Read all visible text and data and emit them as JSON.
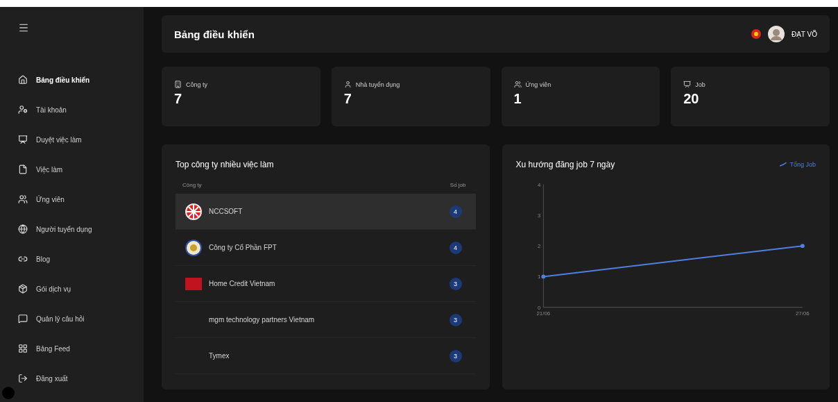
{
  "sidebar": {
    "items": [
      {
        "label": "Bảng điều khiển",
        "selected": true
      },
      {
        "label": "Tài khoản",
        "selected": false
      },
      {
        "label": "Duyệt việc làm",
        "selected": false
      },
      {
        "label": "Việc làm",
        "selected": false
      },
      {
        "label": "Ứng viên",
        "selected": false
      },
      {
        "label": "Người tuyển dụng",
        "selected": false
      },
      {
        "label": "Blog",
        "selected": false
      },
      {
        "label": "Gói dịch vụ",
        "selected": false
      },
      {
        "label": "Quản lý câu hỏi",
        "selected": false
      },
      {
        "label": "Bảng Feed",
        "selected": false
      },
      {
        "label": "Đăng xuất",
        "selected": false
      }
    ]
  },
  "header": {
    "title": "Bảng điều khiển",
    "user": "ĐẠT VÕ"
  },
  "stats": [
    {
      "label": "Công ty",
      "value": "7"
    },
    {
      "label": "Nhà tuyển dụng",
      "value": "7"
    },
    {
      "label": "Ứng viên",
      "value": "1"
    },
    {
      "label": "Job",
      "value": "20"
    }
  ],
  "top_companies": {
    "title": "Top công ty nhiều việc làm",
    "columns": [
      "Công ty",
      "Số job"
    ],
    "rows": [
      {
        "name": "NCCSOFT",
        "jobs": "4",
        "selected": true
      },
      {
        "name": "Công ty Cổ Phần FPT",
        "jobs": "4",
        "selected": false
      },
      {
        "name": "Home Credit Vietnam",
        "jobs": "3",
        "selected": false
      },
      {
        "name": "mgm technology partners Vietnam",
        "jobs": "3",
        "selected": false
      },
      {
        "name": "Tymex",
        "jobs": "3",
        "selected": false
      }
    ]
  },
  "trend": {
    "title": "Xu hướng đăng job 7 ngày",
    "chart_data": {
      "type": "line",
      "categories": [
        "21/06",
        "27/06"
      ],
      "series": [
        {
          "name": "Tổng Job",
          "color": "#4f7fe0",
          "marker": true,
          "values": [
            1,
            2
          ]
        }
      ],
      "ylim": [
        0,
        4
      ],
      "yticks": [
        0,
        1,
        2,
        3,
        4
      ]
    }
  }
}
